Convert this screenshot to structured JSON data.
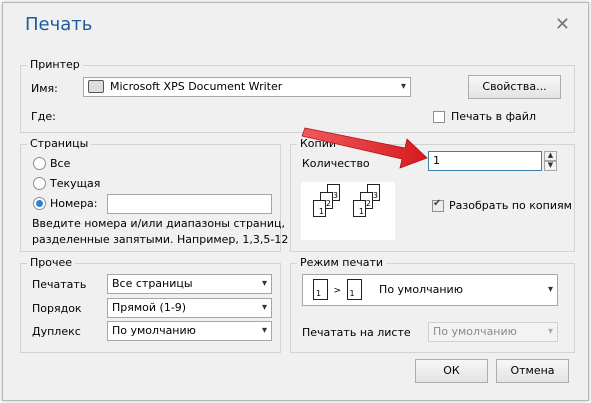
{
  "dialog": {
    "title": "Печать",
    "close_glyph": "✕"
  },
  "printer": {
    "legend": "Принтер",
    "name_label": "Имя:",
    "selected": "Microsoft XPS Document Writer",
    "properties_button": "Свойства...",
    "where_label": "Где:",
    "print_to_file": "Печать в файл",
    "print_to_file_checked": false
  },
  "pages": {
    "legend": "Страницы",
    "options": [
      "Все",
      "Текущая",
      "Номера:"
    ],
    "selected_index": 2,
    "numbers_value": "",
    "hint_line1": "Введите номера и/или диапазоны страниц,",
    "hint_line2": "разделенные запятыми. Например, 1,3,5-12"
  },
  "copies": {
    "legend": "Копии",
    "count_label": "Количество",
    "count_value": "1",
    "collate_label": "Разобрать по копиям",
    "collate_checked": true,
    "page_numbers": [
      "1",
      "2",
      "3",
      "1",
      "2",
      "3"
    ]
  },
  "other": {
    "legend": "Прочее",
    "print_label": "Печатать",
    "print_value": "Все страницы",
    "order_label": "Порядок",
    "order_value": "Прямой (1-9)",
    "duplex_label": "Дуплекс",
    "duplex_value": "По умолчанию"
  },
  "print_mode": {
    "legend": "Режим печати",
    "mode_value": "По умолчанию",
    "page_one": "1",
    "page_one_b": "1",
    "per_sheet_label": "Печатать на листе",
    "per_sheet_value": "По умолчанию"
  },
  "buttons": {
    "ok": "ОК",
    "cancel": "Отмена"
  },
  "colors": {
    "title": "#1e5aa0",
    "arrow": "#e8262a",
    "radio": "#2f7fd6"
  }
}
